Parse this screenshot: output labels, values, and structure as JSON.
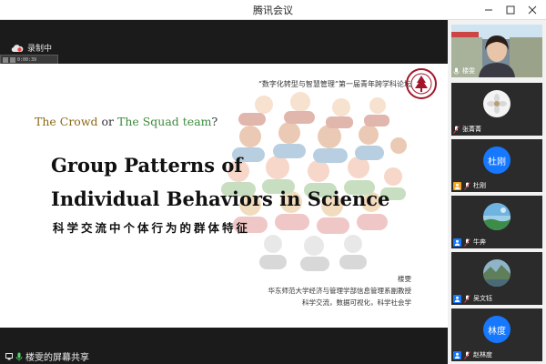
{
  "window": {
    "title": "腾讯会议"
  },
  "recording": {
    "label": "录制中",
    "timer": "0:00:39"
  },
  "slide": {
    "forum": "“数字化转型与智慧管理”第一届青年跨学科论坛",
    "crowd_part1": "The Crowd",
    "crowd_or": " or ",
    "crowd_part2": "The Squad team",
    "crowd_q": "?",
    "title_line1": "Group Patterns of",
    "title_line2": "Individual Behaviors in Science",
    "title_cn": "科学交流中个体行为的群体特征",
    "author_name": "楼雯",
    "author_affiliation": "华东师范大学经济与管理学部信息管理系副教授",
    "author_fields": "科学交流，数据可视化，科学社会学"
  },
  "share": {
    "label": "楼雯的屏幕共享"
  },
  "participants": [
    {
      "name": "楼雯",
      "type": "video"
    },
    {
      "name": "张菁菁",
      "type": "avatar-image"
    },
    {
      "name": "杜刚",
      "type": "avatar-text",
      "avatar_text": "杜刚"
    },
    {
      "name": "牛奔",
      "type": "avatar-image"
    },
    {
      "name": "吴文钰",
      "type": "avatar-image"
    },
    {
      "name": "赵林度",
      "type": "avatar-text",
      "avatar_text": "林度"
    }
  ],
  "colors": {
    "accent": "#1677ff",
    "badge_orange": "#f5a623",
    "crowd_brown": "#8b6914",
    "crowd_green": "#3c8c3c",
    "seal_red": "#a3162a"
  }
}
